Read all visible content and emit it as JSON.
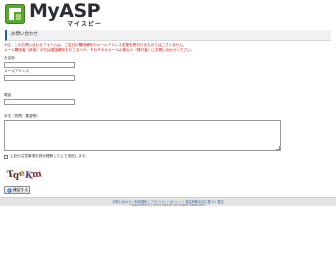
{
  "logo": {
    "name": "MyASP",
    "sub": "マイスピー"
  },
  "page_title": "お問い合わせ",
  "notice_lines": [
    "※注：このお問い合わせフォームは、ご自分の購読解除やメールアドレス変更を受付けるものではございません。",
    "メール購読者（読者）の方は直接解除をおこなうか、それぞれのメールの差出人（発行者）にお問い合わせください。"
  ],
  "form": {
    "name_label": "お名前",
    "email_label": "メールアドレス",
    "phone_label": "電話",
    "message_label": "本文（質問、要望等）",
    "agree_label": "上記の注意事項を読み理解した上で送信します。"
  },
  "captcha_text": "TqeKm",
  "confirm_button": "確認する",
  "footer": {
    "links": "お問い合わせ | 利用規約 | プライバシーポリシー | 特定商取引法に基づく表記",
    "copyright": "Copyright (C) 2024 MyASP All Rights Reserved."
  }
}
